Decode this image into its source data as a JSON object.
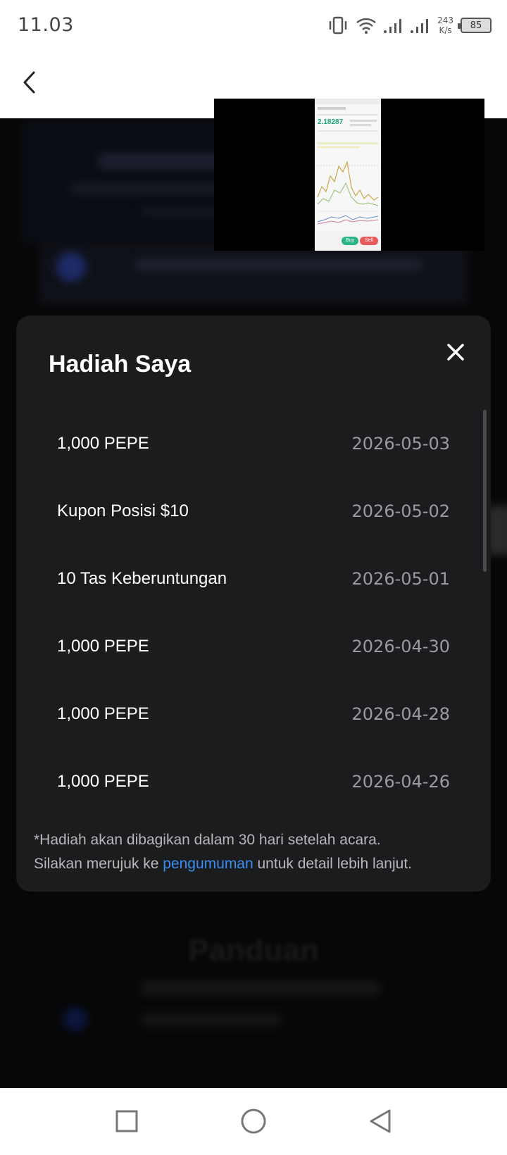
{
  "status_bar": {
    "time": "11.03",
    "net_speed_value": "243",
    "net_speed_unit": "K/s",
    "battery": "85"
  },
  "background": {
    "section_title": "Panduan"
  },
  "thumbnail": {
    "price": "2.18287",
    "buy_label": "Buy",
    "sell_label": "Sell"
  },
  "modal": {
    "title": "Hadiah Saya",
    "rewards": [
      {
        "name": "1,000 PEPE",
        "date": "2026-05-03"
      },
      {
        "name": "Kupon Posisi $10",
        "date": "2026-05-02"
      },
      {
        "name": "10 Tas Keberuntungan",
        "date": "2026-05-01"
      },
      {
        "name": "1,000 PEPE",
        "date": "2026-04-30"
      },
      {
        "name": "1,000 PEPE",
        "date": "2026-04-28"
      },
      {
        "name": "1,000 PEPE",
        "date": "2026-04-26"
      }
    ],
    "note_line1": "*Hadiah akan dibagikan dalam 30 hari setelah acara.",
    "note_prefix": "Silakan merujuk ke ",
    "note_link": "pengumuman",
    "note_suffix": " untuk detail lebih lanjut."
  },
  "icons": {
    "back": "back-arrow-icon",
    "close": "close-icon",
    "vibrate": "vibrate-icon",
    "wifi": "wifi-icon",
    "signal": "signal-icon",
    "recents": "square-icon",
    "home": "circle-icon",
    "nav_back": "triangle-icon"
  },
  "colors": {
    "modal_bg": "#1b1c1e",
    "link": "#3a8cf0",
    "date_text": "#9a9b9f"
  }
}
